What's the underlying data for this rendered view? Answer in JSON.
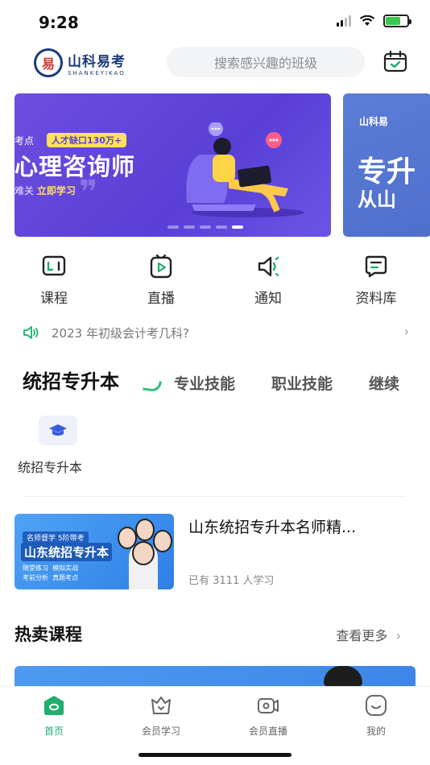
{
  "status_bar": {
    "time": "9:28"
  },
  "header": {
    "logo_text": "山科易考",
    "logo_sub": "SHANKEYIKAO",
    "logo_seal": "易",
    "search_placeholder": "搜索感兴趣的班级",
    "calendar_icon": "calendar-check-icon"
  },
  "banner": {
    "tag_left": "考点",
    "tag_badge": "人才缺口130万+",
    "title": "心理咨询师",
    "sub_prefix": "难关",
    "sub_highlight": "立即学习",
    "second_title_1": "专升",
    "second_title_2": "从山",
    "second_logo": "山科易",
    "active_dot": 4,
    "dot_count": 5
  },
  "quick_nav": [
    {
      "label": "课程",
      "icon": "course-book-icon"
    },
    {
      "label": "直播",
      "icon": "live-play-icon"
    },
    {
      "label": "通知",
      "icon": "speaker-icon"
    },
    {
      "label": "资料库",
      "icon": "library-icon"
    }
  ],
  "notice": {
    "text": "2023 年初级会计考几科?",
    "icon": "megaphone-icon"
  },
  "category_tabs": [
    {
      "label": "统招专升本",
      "active": true
    },
    {
      "label": "专业技能",
      "active": false
    },
    {
      "label": "职业技能",
      "active": false
    },
    {
      "label": "继续",
      "active": false
    }
  ],
  "sub_category": {
    "label": "统招专升本",
    "icon": "graduation-cap-icon"
  },
  "course": {
    "title": "山东统招专升本名师精...",
    "learners": "已有 3111 人学习",
    "thumb_badge": "名师督学 5阶带考",
    "thumb_title": "山东统招专升本",
    "thumb_points": [
      "随堂练习",
      "模拟实战",
      "考前分析",
      "真题考点"
    ]
  },
  "hot_section": {
    "title": "热卖课程",
    "more": "查看更多"
  },
  "tabbar": [
    {
      "label": "首页",
      "icon": "home-icon",
      "active": true
    },
    {
      "label": "会员学习",
      "icon": "member-study-icon",
      "active": false
    },
    {
      "label": "会员直播",
      "icon": "member-live-icon",
      "active": false
    },
    {
      "label": "我的",
      "icon": "profile-smile-icon",
      "active": false
    }
  ],
  "colors": {
    "accent": "#1fae6c",
    "banner_purple": "#5a3fd6",
    "brand_blue": "#1b3a7a"
  }
}
